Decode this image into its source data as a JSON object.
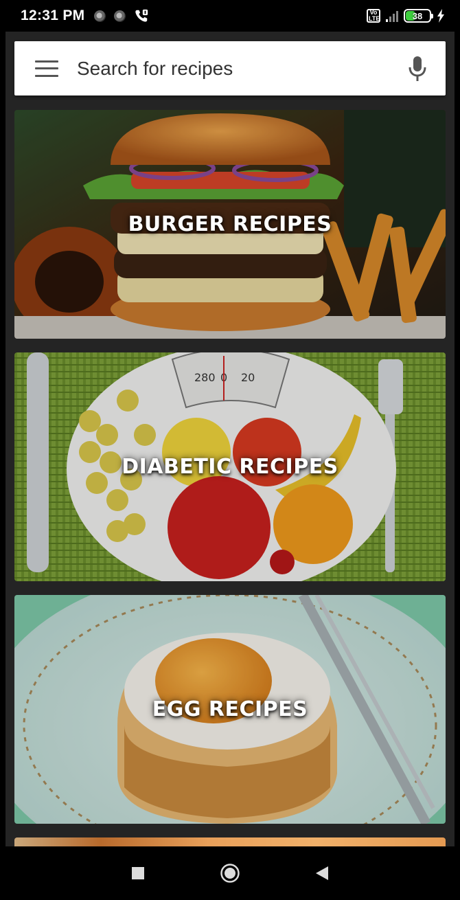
{
  "status_bar": {
    "time": "12:31 PM",
    "volte_label": "Vo\nLTE",
    "battery_level": "38",
    "battery_fraction": 0.38,
    "icons": [
      "record-dot-icon",
      "record-dot-icon",
      "call-forward-icon",
      "volte-icon",
      "signal-icon",
      "battery-icon",
      "charging-bolt-icon"
    ]
  },
  "search": {
    "placeholder": "Search for recipes",
    "menu_icon": "hamburger-menu-icon",
    "voice_icon": "microphone-icon"
  },
  "categories": [
    {
      "title": "BURGER RECIPES"
    },
    {
      "title": "DIABETIC RECIPES"
    },
    {
      "title": "EGG RECIPES"
    }
  ],
  "nav_bar": {
    "icons": [
      "recents-square-icon",
      "home-circle-icon",
      "back-triangle-icon"
    ]
  },
  "colors": {
    "app_background": "#242424",
    "search_background": "#ffffff",
    "battery_fill": "#3ecf3e",
    "card_title": "#ffffff"
  }
}
